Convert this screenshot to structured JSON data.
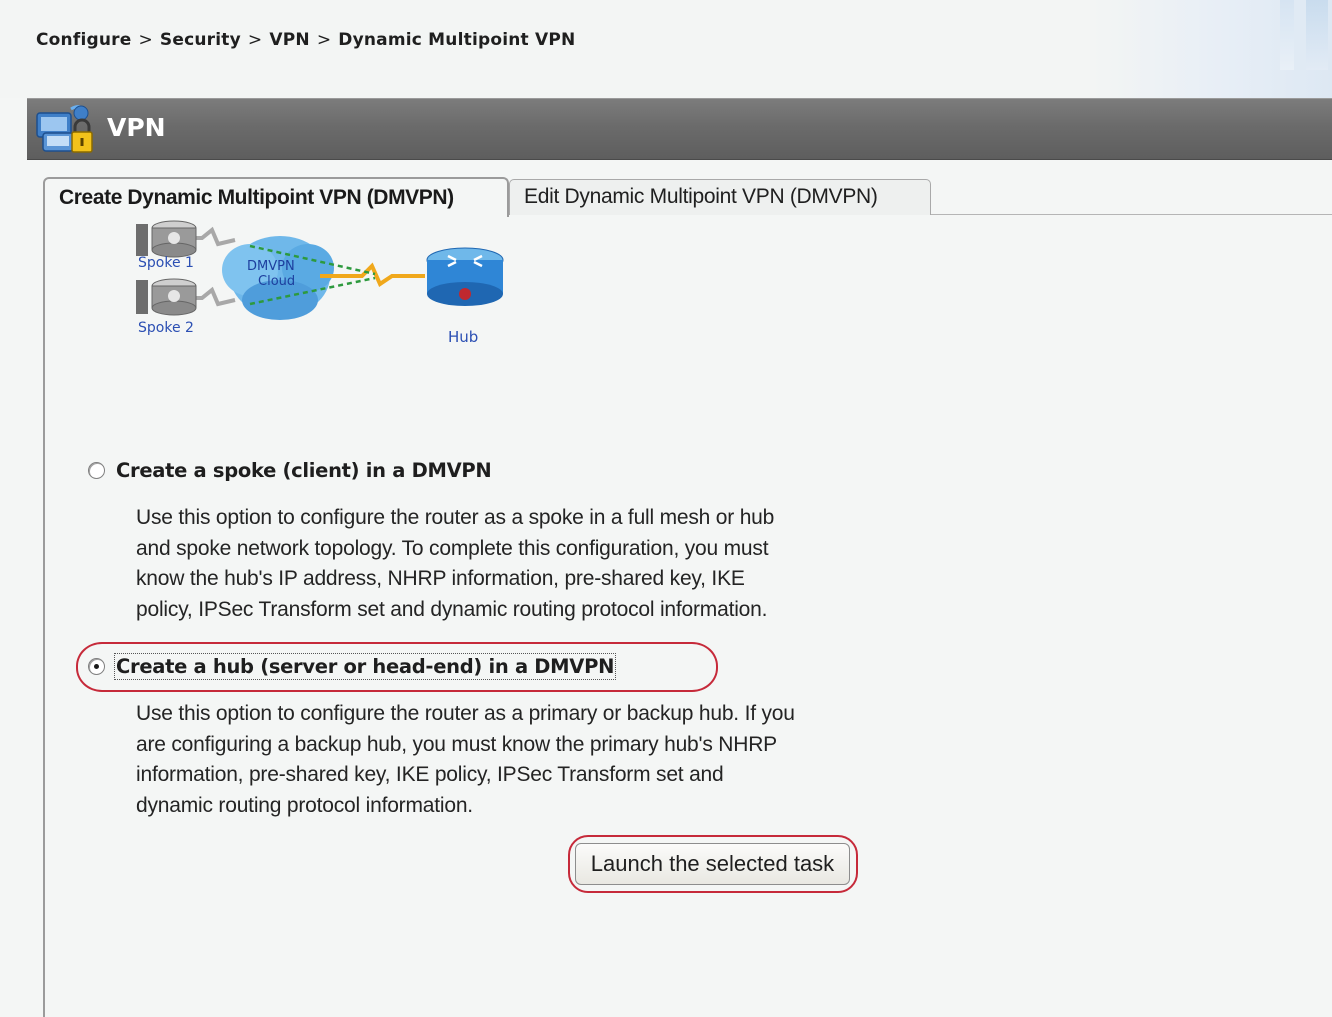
{
  "breadcrumb": {
    "items": [
      "Configure",
      "Security",
      "VPN",
      "Dynamic Multipoint VPN"
    ],
    "separator": ">"
  },
  "header": {
    "title": "VPN",
    "icon": "vpn-lock-icon"
  },
  "tabs": [
    {
      "label": "Create Dynamic Multipoint VPN (DMVPN)",
      "active": true
    },
    {
      "label": "Edit Dynamic Multipoint VPN (DMVPN)",
      "active": false
    }
  ],
  "diagram": {
    "spoke1": "Spoke 1",
    "spoke2": "Spoke 2",
    "cloud_line1": "DMVPN",
    "cloud_line2": "Cloud",
    "hub": "Hub"
  },
  "options": {
    "spoke": {
      "label": "Create a spoke (client) in a DMVPN",
      "checked": false,
      "description": [
        "Use this option to configure the router as a spoke in a full mesh or hub",
        "and spoke network topology. To complete this configuration, you must",
        "know the hub's IP address, NHRP information, pre-shared key, IKE",
        "policy, IPSec Transform set and dynamic routing protocol information."
      ]
    },
    "hub": {
      "label": "Create a hub (server or head-end) in a DMVPN",
      "checked": true,
      "description": [
        "Use this option to configure the router as a primary or backup hub. If you",
        "are configuring a backup hub, you must know the primary hub's NHRP",
        "information, pre-shared key, IKE policy, IPSec Transform set and",
        "dynamic routing protocol information."
      ]
    }
  },
  "launch_button": "Launch the selected task",
  "colors": {
    "highlight": "#c62a3a",
    "header_bg": "#6b6b6b",
    "page_bg": "#f4f6f5"
  }
}
